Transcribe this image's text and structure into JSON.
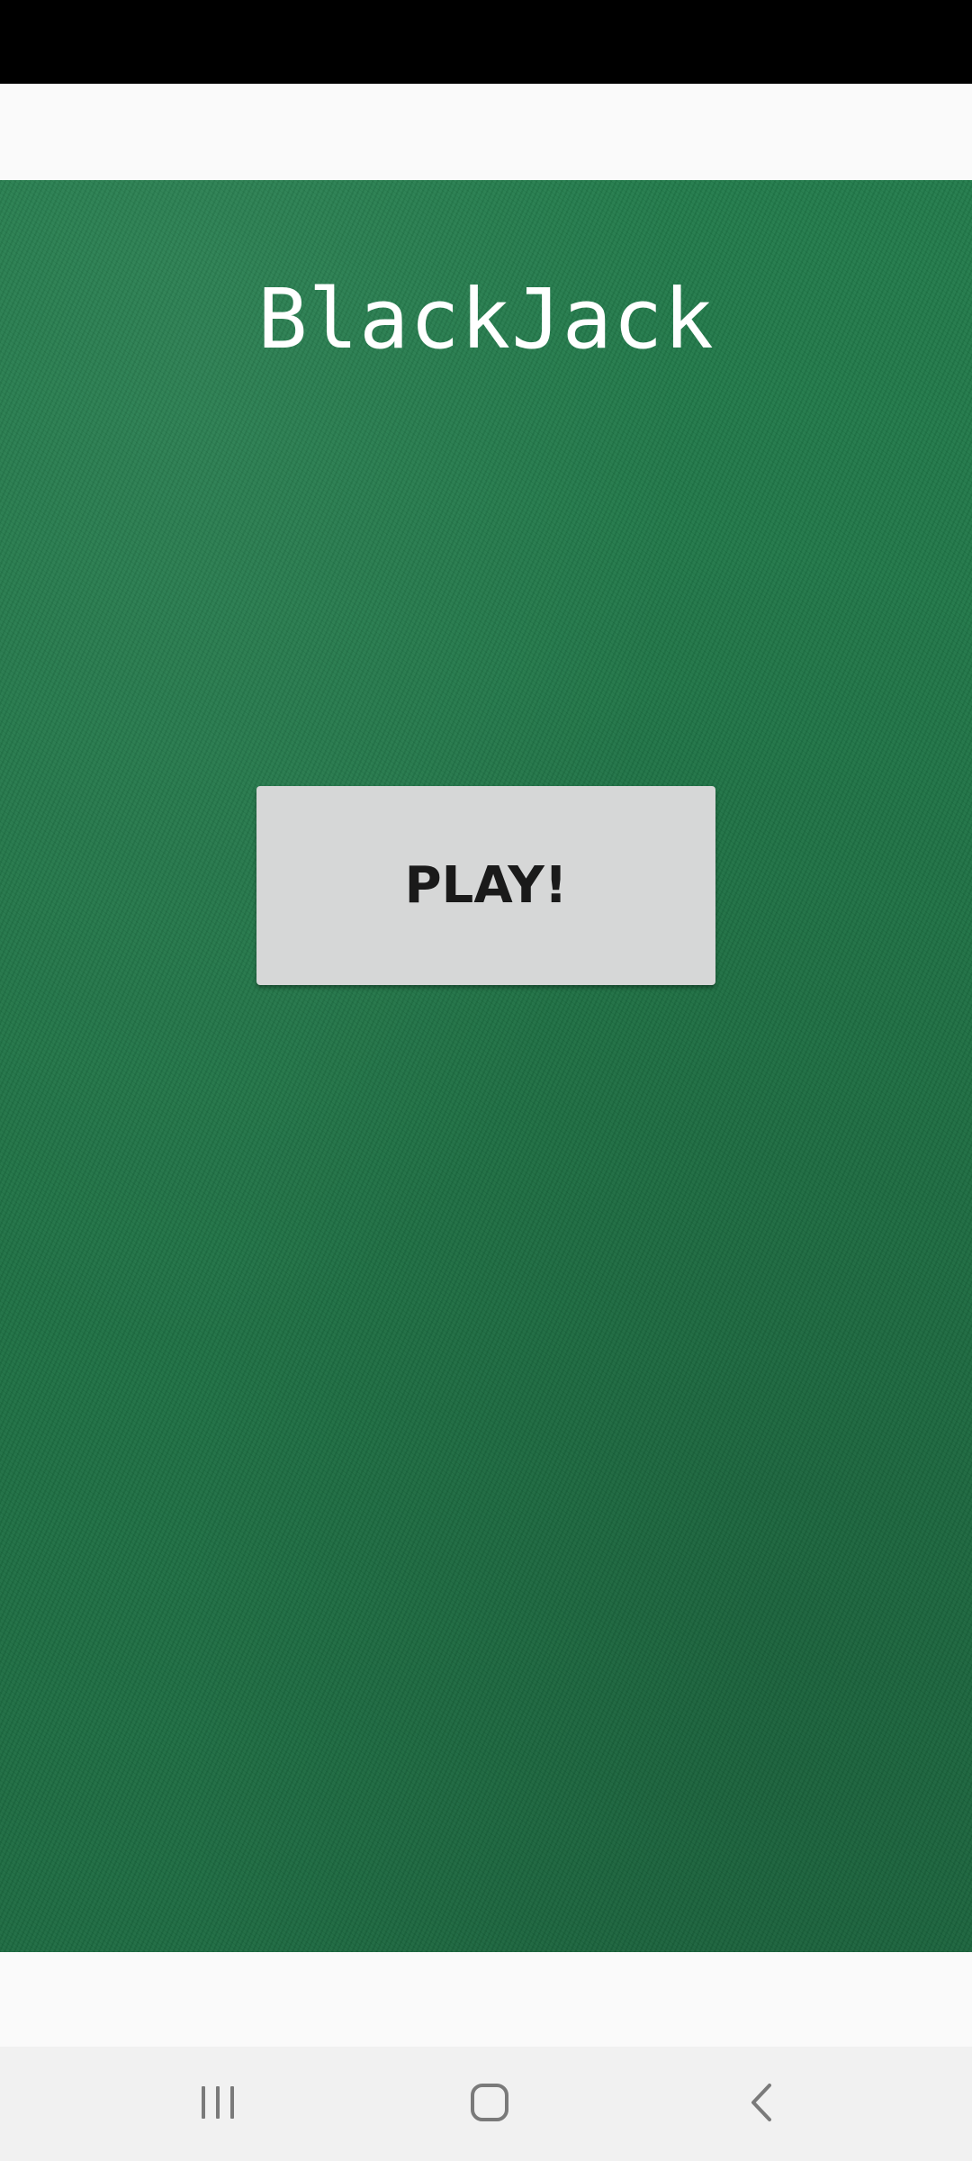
{
  "game": {
    "title": "BlackJack",
    "play_label": "PLAY!"
  },
  "nav": {
    "recent_icon": "recent-apps-icon",
    "home_icon": "home-icon",
    "back_icon": "back-icon"
  },
  "colors": {
    "status_bar": "#000000",
    "felt": "#1f7446",
    "button_bg": "#d6d7d7",
    "button_text": "#1a1a1a",
    "title_text": "#ffffff",
    "nav_bar": "#f1f1f1",
    "nav_icon": "#7a7a7a"
  }
}
